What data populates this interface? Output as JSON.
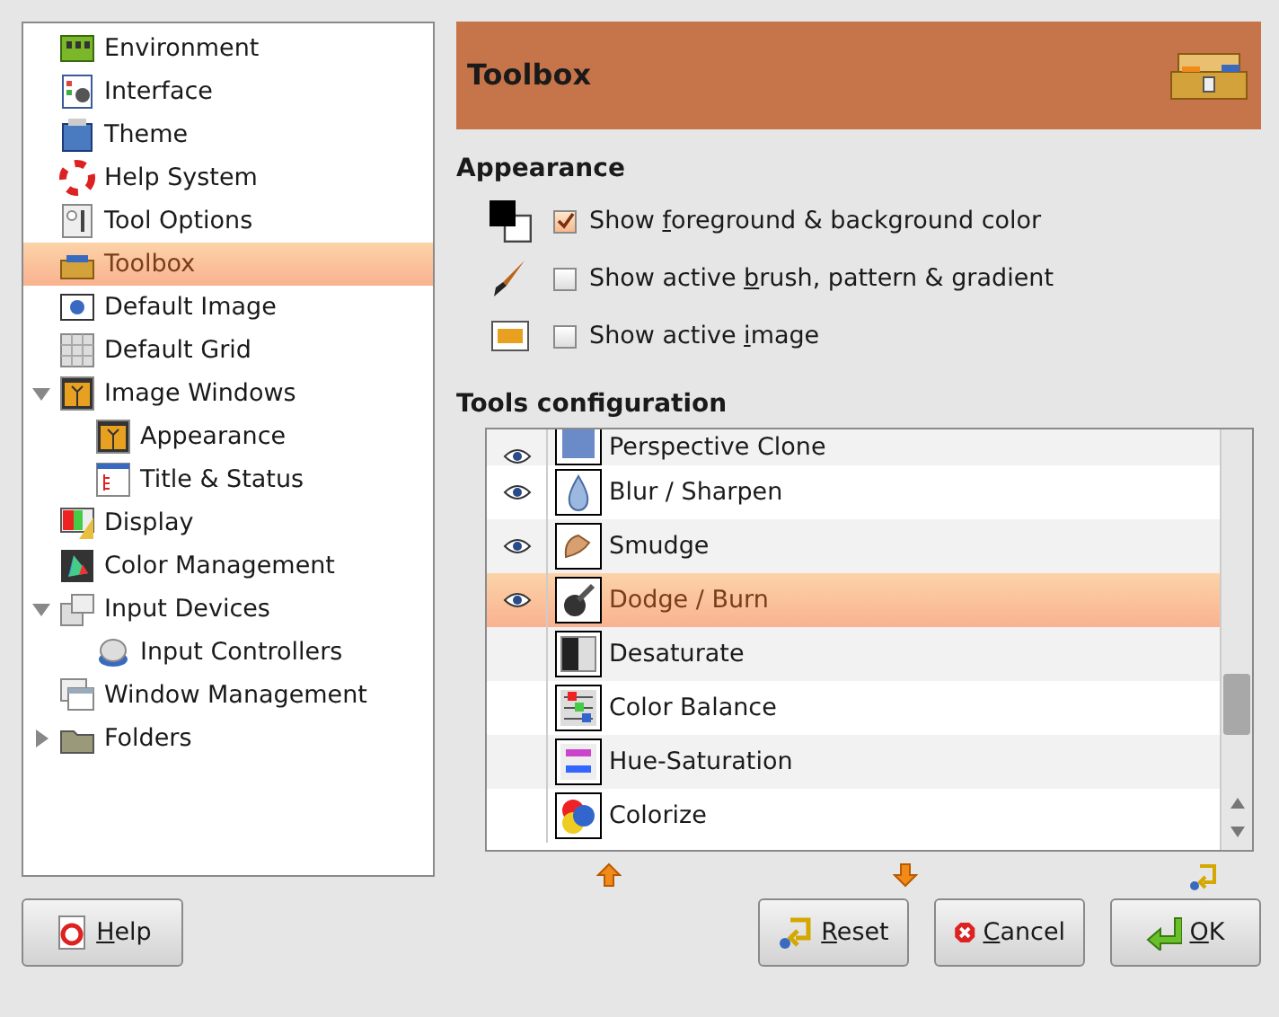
{
  "sidebar": {
    "items": [
      {
        "label": "Environment",
        "selected": false
      },
      {
        "label": "Interface",
        "selected": false
      },
      {
        "label": "Theme",
        "selected": false
      },
      {
        "label": "Help System",
        "selected": false
      },
      {
        "label": "Tool Options",
        "selected": false
      },
      {
        "label": "Toolbox",
        "selected": true
      },
      {
        "label": "Default Image",
        "selected": false
      },
      {
        "label": "Default Grid",
        "selected": false
      },
      {
        "label": "Image Windows",
        "selected": false,
        "expanded": true,
        "children": [
          {
            "label": "Appearance",
            "selected": false
          },
          {
            "label": "Title & Status",
            "selected": false
          }
        ]
      },
      {
        "label": "Display",
        "selected": false
      },
      {
        "label": "Color Management",
        "selected": false
      },
      {
        "label": "Input Devices",
        "selected": false,
        "expanded": true,
        "children": [
          {
            "label": "Input Controllers",
            "selected": false
          }
        ]
      },
      {
        "label": "Window Management",
        "selected": false
      },
      {
        "label": "Folders",
        "selected": false,
        "expanded": false
      }
    ]
  },
  "header": {
    "title": "Toolbox"
  },
  "appearance": {
    "title": "Appearance",
    "options": [
      {
        "before": "Show ",
        "key": "f",
        "after": "oreground & background color",
        "checked": true
      },
      {
        "before": "Show active ",
        "key": "b",
        "after": "rush, pattern & gradient",
        "checked": false
      },
      {
        "before": "Show active ",
        "key": "i",
        "after": "mage",
        "checked": false
      }
    ]
  },
  "tools": {
    "title": "Tools configuration",
    "rows": [
      {
        "label": "Perspective Clone",
        "visible": true,
        "selected": false
      },
      {
        "label": "Blur / Sharpen",
        "visible": true,
        "selected": false
      },
      {
        "label": "Smudge",
        "visible": true,
        "selected": false
      },
      {
        "label": "Dodge / Burn",
        "visible": true,
        "selected": true
      },
      {
        "label": "Desaturate",
        "visible": false,
        "selected": false
      },
      {
        "label": "Color Balance",
        "visible": false,
        "selected": false
      },
      {
        "label": "Hue-Saturation",
        "visible": false,
        "selected": false
      },
      {
        "label": "Colorize",
        "visible": false,
        "selected": false
      }
    ]
  },
  "buttons": [
    {
      "key": "H",
      "after": "elp",
      "kind": "help"
    },
    {
      "key": "R",
      "after": "eset",
      "kind": "reset"
    },
    {
      "key": "C",
      "after": "ancel",
      "kind": "cancel"
    },
    {
      "key": "O",
      "after": "K",
      "kind": "ok"
    }
  ]
}
